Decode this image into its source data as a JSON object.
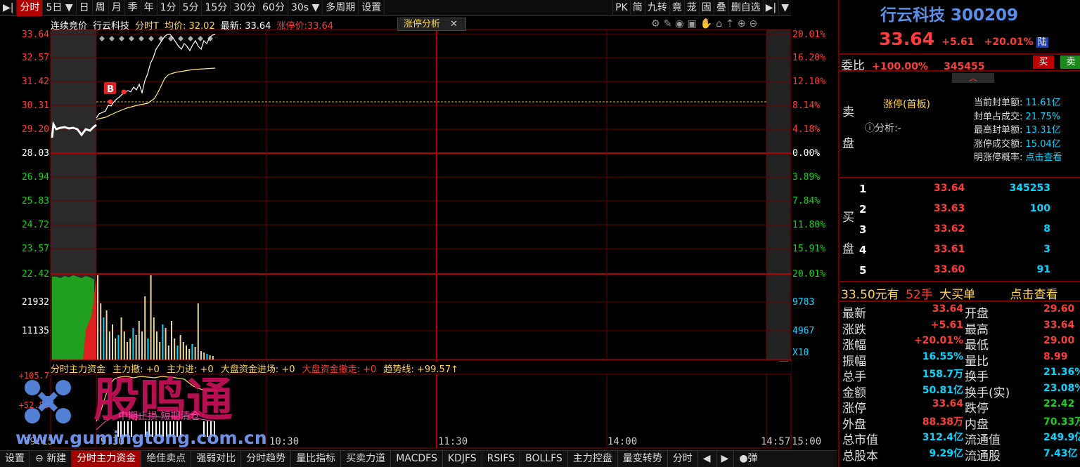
{
  "toolbar": {
    "left": [
      "分时",
      "5日",
      "日",
      "周",
      "月",
      "季",
      "年",
      "1分",
      "5分",
      "15分",
      "30分",
      "60分",
      "30s",
      "多周期",
      "设置"
    ],
    "right": [
      "PK",
      "简",
      "九转",
      "竟",
      "茏",
      "固",
      "叠",
      "删自选"
    ]
  },
  "info": {
    "mode": "连续竞价",
    "name": "行云科技",
    "indicator": "分时T",
    "avg_label": "均价: 32.02",
    "latest_label": "最新: 33.64",
    "limit_label": "涨停价:33.64",
    "tag": "涨停分析",
    "tag_close": "✕"
  },
  "price_axis": {
    "left": [
      "33.64",
      "32.57",
      "31.42",
      "30.31",
      "29.20",
      "28.03",
      "26.94",
      "25.83",
      "24.72",
      "23.57",
      "22.42"
    ],
    "right": [
      "20.01%",
      "16.20%",
      "12.10%",
      "8.14%",
      "4.18%",
      "0.00%",
      "3.89%",
      "7.84%",
      "11.80%",
      "15.91%",
      "20.01%"
    ]
  },
  "volume_axis": {
    "left": [
      "21932",
      "11135"
    ],
    "right": [
      "9783",
      "4967",
      "X10"
    ]
  },
  "volume_legend": {
    "title": "分时主力资金",
    "items": [
      "主力撤: +0",
      "主力进: +0",
      "大盘资金进场: +0",
      "大盘资金撤走: +0"
    ],
    "trend": "趋势线: +99.57↑"
  },
  "time_axis": [
    "9:30",
    "10:30",
    "11:30",
    "14:00",
    "14:57",
    "15:00"
  ],
  "lower_axis": [
    "+105.7",
    "+52.83",
    "09:15"
  ],
  "bottom_tabs": [
    "设置",
    "新建",
    "分时主力资金",
    "绝佳卖点",
    "强弱对比",
    "分时趋势",
    "量比指标",
    "买卖力道",
    "MACDFS",
    "KDJFS",
    "RSIFS",
    "BOLLFS",
    "主力控盘",
    "量变转势",
    "分时"
  ],
  "bottom_toggle": "弹",
  "marker": "B",
  "stock": {
    "name": "行云科技",
    "code": "300209",
    "price": "33.64",
    "change": "+5.61",
    "pct": "+20.01%",
    "flag": "陆",
    "webi_label": "委比",
    "webi_pct": "+100.00%",
    "webi_val": "345455",
    "buy_btn": "买",
    "sell_btn": "卖"
  },
  "limit_info": {
    "sell_label": [
      "卖",
      "盘"
    ],
    "status": "涨停(首板)",
    "analysis": "分析:-",
    "rows": [
      {
        "label": "当前封单额:",
        "value": "11.61亿"
      },
      {
        "label": "封单占成交:",
        "value": "21.75%"
      },
      {
        "label": "最高封单额:",
        "value": "13.31亿"
      },
      {
        "label": "涨停成交额:",
        "value": "15.04亿"
      },
      {
        "label": "明涨停概率:",
        "value": "点击查看"
      }
    ]
  },
  "buy_orders": {
    "label": [
      "买",
      "盘"
    ],
    "rows": [
      {
        "level": "1",
        "price": "33.64",
        "qty": "345253"
      },
      {
        "level": "2",
        "price": "33.63",
        "qty": "100"
      },
      {
        "level": "3",
        "price": "33.62",
        "qty": "8"
      },
      {
        "level": "4",
        "price": "33.61",
        "qty": "3"
      },
      {
        "level": "5",
        "price": "33.60",
        "qty": "91"
      }
    ]
  },
  "big_order": {
    "price": "33.50元有",
    "qty": "52手",
    "text": "大买单",
    "link": "点击查看"
  },
  "quote": [
    {
      "l1": "最新",
      "v1": "33.64",
      "c1": "red",
      "l2": "开盘",
      "v2": "29.60",
      "c2": "red"
    },
    {
      "l1": "涨跌",
      "v1": "+5.61",
      "c1": "red",
      "l2": "最高",
      "v2": "33.64",
      "c2": "red"
    },
    {
      "l1": "涨幅",
      "v1": "+20.01%",
      "c1": "red",
      "l2": "最低",
      "v2": "29.00",
      "c2": "red"
    },
    {
      "l1": "振幅",
      "v1": "16.55%",
      "c1": "cyan",
      "l2": "量比",
      "v2": "8.99",
      "c2": "red"
    },
    {
      "l1": "总手",
      "v1": "158.7万",
      "c1": "cyan",
      "l2": "换手",
      "v2": "21.36%",
      "c2": "cyan"
    },
    {
      "l1": "金额",
      "v1": "50.81亿",
      "c1": "cyan",
      "l2": "换手(实)",
      "v2": "23.08%",
      "c2": "cyan"
    },
    {
      "l1": "涨停",
      "v1": "33.64",
      "c1": "red",
      "l2": "跌停",
      "v2": "22.42",
      "c2": "green"
    },
    {
      "l1": "外盘",
      "v1": "88.38万",
      "c1": "red",
      "l2": "内盘",
      "v2": "70.33万",
      "c2": "green"
    },
    {
      "l1": "总市值",
      "v1": "312.4亿",
      "c1": "cyan",
      "l2": "流通值",
      "v2": "249.9亿",
      "c2": "cyan"
    },
    {
      "l1": "总股本",
      "v1": "9.29亿",
      "c1": "cyan",
      "l2": "流通股",
      "v2": "7.43亿",
      "c2": "cyan"
    }
  ],
  "watermark": {
    "brand": "股鸣通",
    "url": "www.gumingtong.com.cn",
    "overlay": "中期止损 短期清仓"
  }
}
